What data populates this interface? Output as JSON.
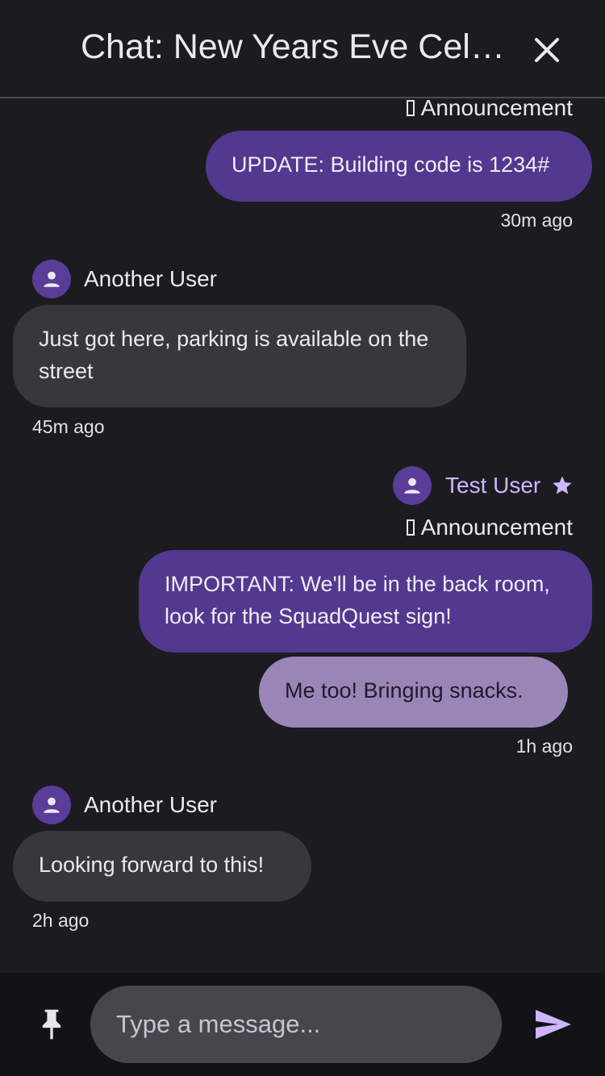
{
  "header": {
    "title": "Chat: New Years Eve Celebration",
    "close_icon": "close-icon"
  },
  "messages": [
    {
      "announcement_label": "Announcement",
      "bubbles": [
        {
          "text": "UPDATE: Building code is 1234#"
        }
      ],
      "time": "30m ago"
    },
    {
      "sender": "Another User",
      "bubbles": [
        {
          "text": "Just got here, parking is available on the street"
        }
      ],
      "time": "45m ago"
    },
    {
      "sender": "Test User",
      "sender_badge": "star-icon",
      "announcement_label": "Announcement",
      "bubbles": [
        {
          "text": "IMPORTANT: We'll be in the back room, look for the SquadQuest sign!"
        },
        {
          "text": "Me too! Bringing snacks."
        }
      ],
      "time": "1h ago"
    },
    {
      "sender": "Another User",
      "bubbles": [
        {
          "text": "Looking forward to this!"
        }
      ],
      "time": "2h ago"
    }
  ],
  "composer": {
    "placeholder": "Type a message...",
    "pin_icon": "pin-icon",
    "send_icon": "send-icon"
  },
  "colors": {
    "background": "#1c1b20",
    "own_bubble": "#52388e",
    "own_bubble_light": "#9a86b6",
    "other_bubble": "#39373e",
    "accent": "#cdb6ff",
    "avatar": "#5a3c99"
  }
}
